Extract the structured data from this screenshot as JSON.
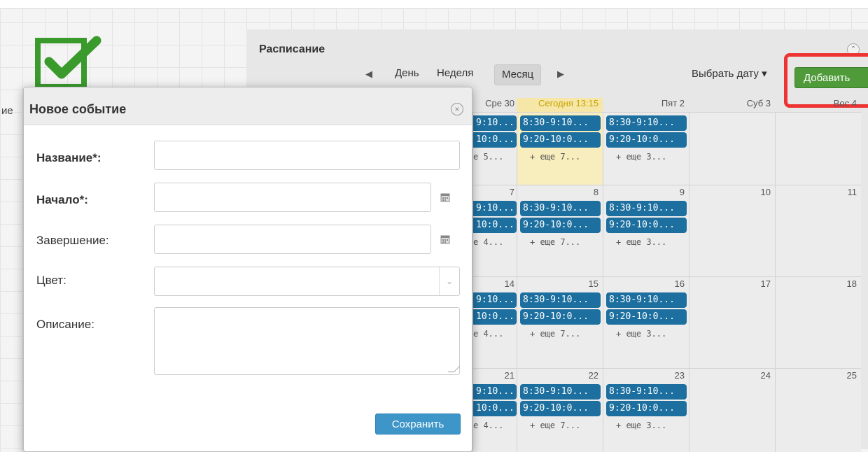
{
  "background_label_cut": "ие",
  "schedule": {
    "title": "Расписание",
    "nav": {
      "day": "День",
      "week": "Неделя",
      "month": "Месяц",
      "pick_date": "Выбрать дату",
      "add": "Добавить"
    },
    "headers": [
      "Сре 30",
      "Сегодня 13:15",
      "Пят 2",
      "Суб 3",
      "Вос 4"
    ],
    "weeks": [
      {
        "days": [
          "",
          "",
          "",
          "",
          ""
        ],
        "events": [
          [
            "9:10...",
            "10:0...",
            "е 5..."
          ],
          [
            "8:30-9:10...",
            "9:20-10:0...",
            "+ еще 7..."
          ],
          [
            "8:30-9:10...",
            "9:20-10:0...",
            "+ еще 3..."
          ],
          [],
          []
        ]
      },
      {
        "days": [
          "7",
          "8",
          "9",
          "10",
          "11"
        ],
        "events": [
          [
            "9:10...",
            "10:0...",
            "е 4..."
          ],
          [
            "8:30-9:10...",
            "9:20-10:0...",
            "+ еще 7..."
          ],
          [
            "8:30-9:10...",
            "9:20-10:0...",
            "+ еще 3..."
          ],
          [],
          []
        ]
      },
      {
        "days": [
          "14",
          "15",
          "16",
          "17",
          "18"
        ],
        "events": [
          [
            "9:10...",
            "10:0...",
            "е 4..."
          ],
          [
            "8:30-9:10...",
            "9:20-10:0...",
            "+ еще 7..."
          ],
          [
            "8:30-9:10...",
            "9:20-10:0...",
            "+ еще 3..."
          ],
          [],
          []
        ]
      },
      {
        "days": [
          "21",
          "22",
          "23",
          "24",
          "25"
        ],
        "events": [
          [
            "9:10...",
            "10:0...",
            "е 4..."
          ],
          [
            "8:30-9:10...",
            "9:20-10:0...",
            "+ еще 7..."
          ],
          [
            "8:30-9:10...",
            "9:20-10:0...",
            "+ еще 3..."
          ],
          [],
          []
        ]
      }
    ]
  },
  "dialog": {
    "title": "Новое событие",
    "fields": {
      "name": {
        "label": "Название*:",
        "value": ""
      },
      "start": {
        "label": "Начало*:",
        "value": ""
      },
      "end": {
        "label": "Завершение:",
        "value": ""
      },
      "color": {
        "label": "Цвет:",
        "value": ""
      },
      "description": {
        "label": "Описание:",
        "value": ""
      }
    },
    "save": "Сохранить"
  },
  "colors": {
    "event": "#1c6f9f",
    "add_button": "#4f9a39",
    "save_button": "#3d95c8",
    "today": "#f8edbd",
    "highlight": "#e33333"
  }
}
